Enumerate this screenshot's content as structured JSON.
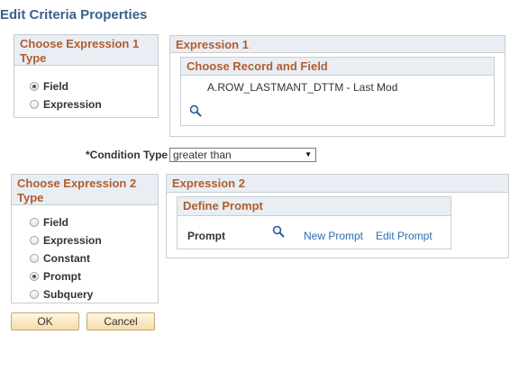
{
  "page": {
    "title": "Edit Criteria Properties"
  },
  "expr1_type": {
    "heading": "Choose Expression 1 Type",
    "options": [
      {
        "label": "Field",
        "selected": true
      },
      {
        "label": "Expression",
        "selected": false
      }
    ]
  },
  "expression1": {
    "heading": "Expression 1",
    "subheading": "Choose Record and Field",
    "field_value": "A.ROW_LASTMANT_DTTM - Last Mod",
    "lookup_icon": "search-icon"
  },
  "condition": {
    "label": "*Condition Type",
    "selected": "greater than"
  },
  "expr2_type": {
    "heading": "Choose Expression 2 Type",
    "options": [
      {
        "label": "Field",
        "selected": false
      },
      {
        "label": "Expression",
        "selected": false
      },
      {
        "label": "Constant",
        "selected": false
      },
      {
        "label": "Prompt",
        "selected": true
      },
      {
        "label": "Subquery",
        "selected": false
      }
    ]
  },
  "expression2": {
    "heading": "Expression 2",
    "subheading": "Define Prompt",
    "prompt_label": "Prompt",
    "lookup_icon": "search-icon",
    "new_prompt": "New Prompt",
    "edit_prompt": "Edit Prompt"
  },
  "buttons": {
    "ok": "OK",
    "cancel": "Cancel"
  },
  "colors": {
    "title": "#3b5f8c",
    "heading": "#b45c2c",
    "link": "#2f6bb3",
    "header_bg": "#e8eef4"
  }
}
